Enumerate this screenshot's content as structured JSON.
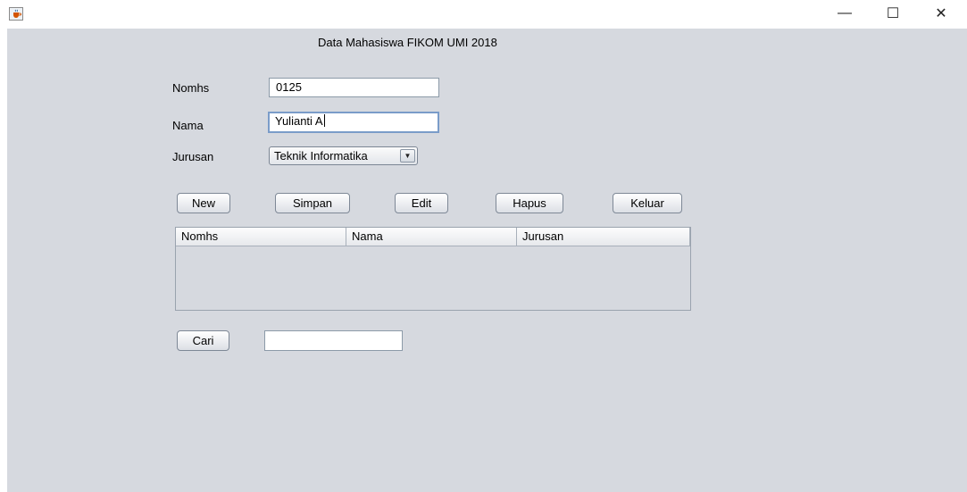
{
  "window": {
    "icon": "java-cup-icon",
    "controls": {
      "minimize": "—",
      "maximize": "☐",
      "close": "✕"
    }
  },
  "form": {
    "title": "Data Mahasiswa FIKOM UMI 2018",
    "nomhs_label": "Nomhs",
    "nomhs_value": "0125",
    "nama_label": "Nama",
    "nama_value": "Yulianti A",
    "jurusan_label": "Jurusan",
    "jurusan_value": "Teknik Informatika"
  },
  "buttons": {
    "new": "New",
    "simpan": "Simpan",
    "edit": "Edit",
    "hapus": "Hapus",
    "keluar": "Keluar",
    "cari": "Cari"
  },
  "table": {
    "columns": [
      "Nomhs",
      "Nama",
      "Jurusan"
    ],
    "rows": []
  },
  "search": {
    "value": ""
  },
  "colors": {
    "panel": "#d6d9df",
    "focus_border": "#7a9cc9"
  }
}
